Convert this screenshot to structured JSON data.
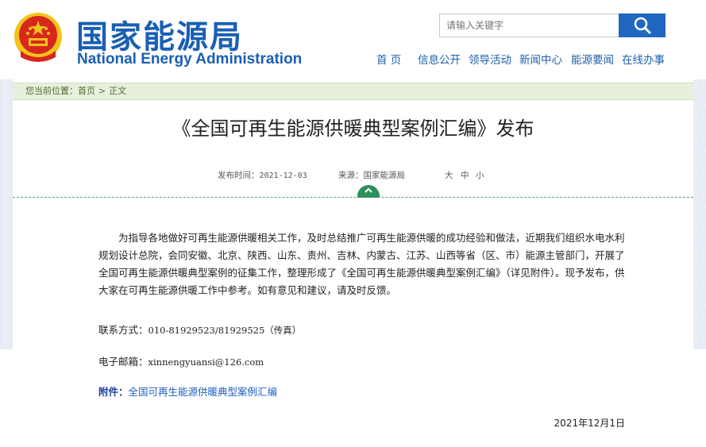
{
  "header": {
    "site_name_cn": "国家能源局",
    "site_name_en": "National Energy Administration",
    "search_placeholder": "请输入关键字"
  },
  "nav": {
    "items": [
      "首 页",
      "信息公开",
      "领导活动",
      "新闻中心",
      "能源要闻",
      "在线办事"
    ]
  },
  "breadcrumb": {
    "prefix": "您当前位置：",
    "home": "首页",
    "separator": ">",
    "current": "正文"
  },
  "article": {
    "title": "《全国可再生能源供暖典型案例汇编》发布",
    "publish_label": "发布时间：",
    "publish_date": "2021-12-03",
    "source_label": "来源：",
    "source": "国家能源局",
    "font_sizes": [
      "大",
      "中",
      "小"
    ],
    "paragraph1": "为指导各地做好可再生能源供暖相关工作，及时总结推广可再生能源供暖的成功经验和做法，近期我们组织水电水利规划设计总院，会同安徽、北京、陕西、山东、贵州、吉林、内蒙古、江苏、山西等省（区、市）能源主管部门，开展了全国可再生能源供暖典型案例的征集工作，整理形成了《全国可再生能源供暖典型案例汇编》（详见附件）。现予发布，供大家在可再生能源供暖工作中参考。如有意见和建议，请及时反馈。",
    "contact_label": "联系方式：",
    "contact_value": "010-81929523/81929525（传真）",
    "email_label": "电子邮箱：",
    "email_value": "xinnengyuansi@126.com",
    "attachment_label": "附件：",
    "attachment_link": "全国可再生能源供暖典型案例汇编",
    "sign_date": "2021年12月1日"
  },
  "colors": {
    "brand_blue": "#1a5fb4",
    "search_button": "#1f67c0",
    "breadcrumb_bg": "#e6f0dc",
    "divider_green": "#5aa77a",
    "toggle_green": "#2f8f5b",
    "emblem_red": "#d7261e",
    "emblem_gold": "#f2c318"
  },
  "icons": [
    "national-emblem-icon",
    "search-icon",
    "chevron-up-icon"
  ]
}
